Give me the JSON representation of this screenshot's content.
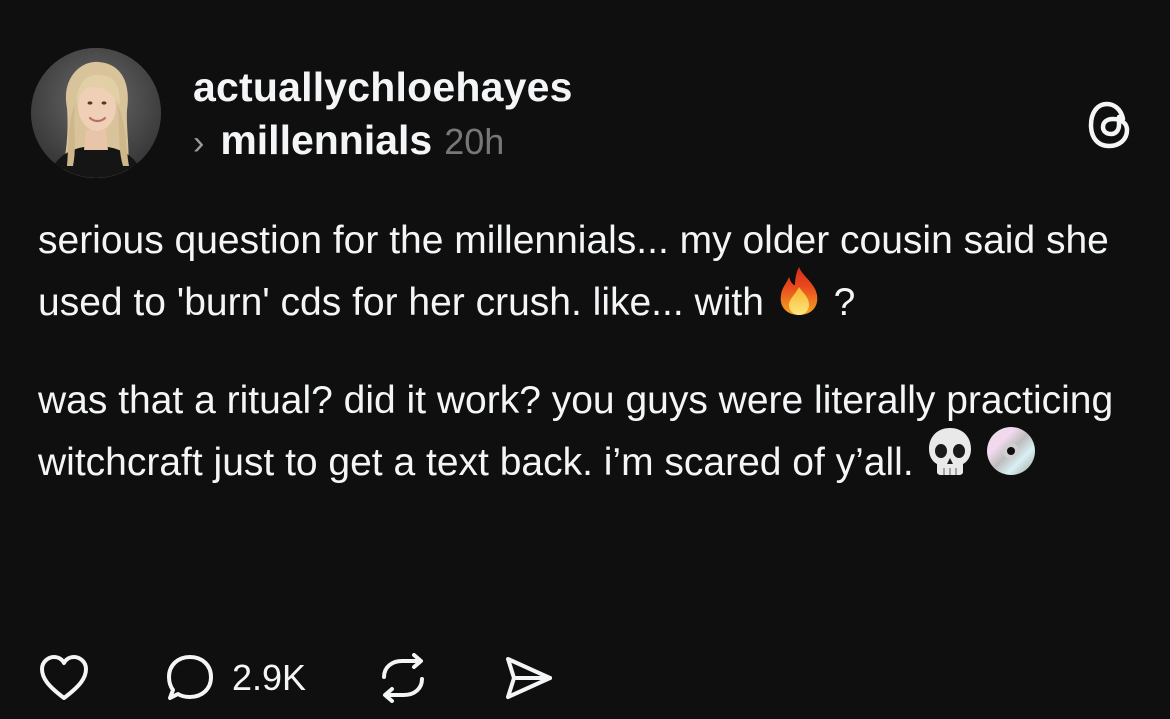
{
  "post": {
    "username": "actuallychloehayes",
    "community": "millennials",
    "time": "20h",
    "paragraph1_text": "serious question for the millennials... my older cousin said she used to 'burn' cds for her crush. like... with",
    "paragraph1_after_emoji": "?",
    "paragraph2_text": "was that a ritual? did it work? you guys were literally practicing witchcraft just to get a text back. i’m scared of y’all.",
    "emojis": [
      "fire-emoji",
      "skull-emoji",
      "cd-emoji"
    ]
  },
  "actions": {
    "like_icon": "heart-icon",
    "reply_icon": "comment-icon",
    "reply_count": "2.9K",
    "repost_icon": "repost-icon",
    "share_icon": "send-icon"
  },
  "colors": {
    "background": "#0f0f0f",
    "text": "#f3f5f7",
    "muted": "#777777"
  }
}
